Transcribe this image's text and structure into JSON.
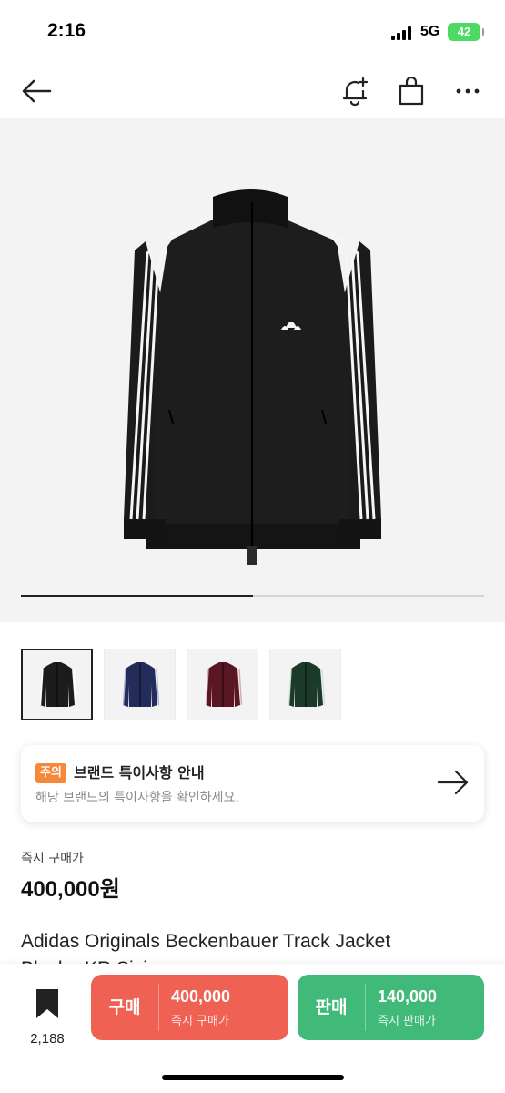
{
  "status_bar": {
    "time": "2:16",
    "network": "5G",
    "battery": "42"
  },
  "nav": {
    "back_icon": "arrow-left-icon",
    "alert_icon": "bell-plus-icon",
    "bag_icon": "shopping-bag-icon",
    "more_icon": "more-dots-icon"
  },
  "gallery": {
    "progress": 0.5,
    "thumbnails": [
      {
        "color_name": "black",
        "color": "#1c1c1c",
        "stripe": "#ffffff",
        "selected": true
      },
      {
        "color_name": "navy",
        "color": "#242d5a",
        "stripe": "#a9b0d0",
        "selected": false
      },
      {
        "color_name": "burgundy",
        "color": "#5a1622",
        "stripe": "#d9a9ae",
        "selected": false
      },
      {
        "color_name": "green",
        "color": "#1c3a2a",
        "stripe": "#d3e1d6",
        "selected": false
      }
    ]
  },
  "notice": {
    "badge": "주의",
    "title": "브랜드 특이사항 안내",
    "description": "해당 브랜드의 특이사항을 확인하세요.",
    "badge_color": "#f5883a"
  },
  "price": {
    "label": "즉시 구매가",
    "value": "400,000원"
  },
  "product": {
    "name": "Adidas Originals Beckenbauer Track Jacket",
    "name_line2": "Black - KR Sizing"
  },
  "bottom_bar": {
    "wish_count": "2,188",
    "buy": {
      "type": "구매",
      "price": "400,000",
      "sub": "즉시 구매가",
      "color": "#ef6253"
    },
    "sell": {
      "type": "판매",
      "price": "140,000",
      "sub": "즉시 판매가",
      "color": "#41b979"
    }
  }
}
